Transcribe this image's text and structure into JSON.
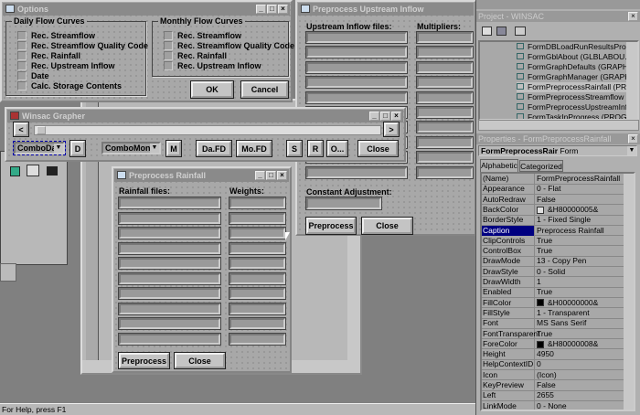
{
  "status_bar": "For Help, press F1",
  "options": {
    "title": "Options",
    "daily_group": "Daily Flow Curves",
    "daily": [
      "Rec. Streamflow",
      "Rec. Streamflow Quality Code",
      "Rec. Rainfall",
      "Rec. Upstream Inflow",
      "Date",
      "Calc. Storage Contents"
    ],
    "monthly_group": "Monthly Flow Curves",
    "monthly": [
      "Rec. Streamflow",
      "Rec. Streamflow Quality Code",
      "Rec. Rainfall",
      "Rec. Upstream Inflow"
    ],
    "ok": "OK",
    "cancel": "Cancel"
  },
  "upstream": {
    "title": "Preprocess Upstream Inflow",
    "files_label": "Upstream Inflow files:",
    "mult_label": "Multipliers:",
    "const_label": "Constant Adjustment:",
    "preprocess": "Preprocess",
    "close": "Close"
  },
  "grapher": {
    "title": "Winsac Grapher",
    "prev": "<",
    "next": ">",
    "combo_daily": "ComboDai",
    "d": "D",
    "combo_month": "ComboMonth",
    "m": "M",
    "dafd": "Da.FD",
    "mofd": "Mo.FD",
    "s": "S",
    "r": "R",
    "o": "O...",
    "close": "Close"
  },
  "rainfall": {
    "title": "Preprocess Rainfall",
    "files_label": "Rainfall files:",
    "weights_label": "Weights:",
    "preprocess": "Preprocess",
    "close": "Close"
  },
  "project": {
    "title": "Project - WINSAC",
    "items": [
      "FormDBLoadRunResultsProgress",
      "FormGblAbout (GLBLABOU.FRM",
      "FormGraphDefaults (GRAPHDFL",
      "FormGraphManager (GRAPHMGR",
      "FormPreprocessRainfall (PREPRA",
      "FormPreprocessStreamflow (PRE",
      "FormPreprocessUpstreamInflow",
      "FormTaskInProgress (PROGTASK"
    ],
    "selected": 4
  },
  "properties": {
    "title": "Properties - FormPreprocessRainfall",
    "object": "FormPreprocessRair",
    "object_type": "Form",
    "tabs": [
      "Alphabetic",
      "Categorized"
    ],
    "rows": [
      [
        "(Name)",
        "FormPreprocessRainfall"
      ],
      [
        "Appearance",
        "0 - Flat"
      ],
      [
        "AutoRedraw",
        "False"
      ],
      [
        "BackColor",
        "&H80000005&"
      ],
      [
        "BorderStyle",
        "1 - Fixed Single"
      ],
      [
        "Caption",
        "Preprocess Rainfall"
      ],
      [
        "ClipControls",
        "True"
      ],
      [
        "ControlBox",
        "True"
      ],
      [
        "DrawMode",
        "13 - Copy Pen"
      ],
      [
        "DrawStyle",
        "0 - Solid"
      ],
      [
        "DrawWidth",
        "1"
      ],
      [
        "Enabled",
        "True"
      ],
      [
        "FillColor",
        "&H00000000&"
      ],
      [
        "FillStyle",
        "1 - Transparent"
      ],
      [
        "Font",
        "MS Sans Serif"
      ],
      [
        "FontTransparent",
        "True"
      ],
      [
        "ForeColor",
        "&H80000008&"
      ],
      [
        "Height",
        "4950"
      ],
      [
        "HelpContextID",
        "0"
      ],
      [
        "Icon",
        "(Icon)"
      ],
      [
        "KeyPreview",
        "False"
      ],
      [
        "Left",
        "2655"
      ],
      [
        "LinkMode",
        "0 - None"
      ]
    ],
    "swatches": {
      "3": "#e0e0e0",
      "12": "#000000",
      "16": "#000000"
    },
    "selected": 5,
    "accent": "#000080"
  }
}
